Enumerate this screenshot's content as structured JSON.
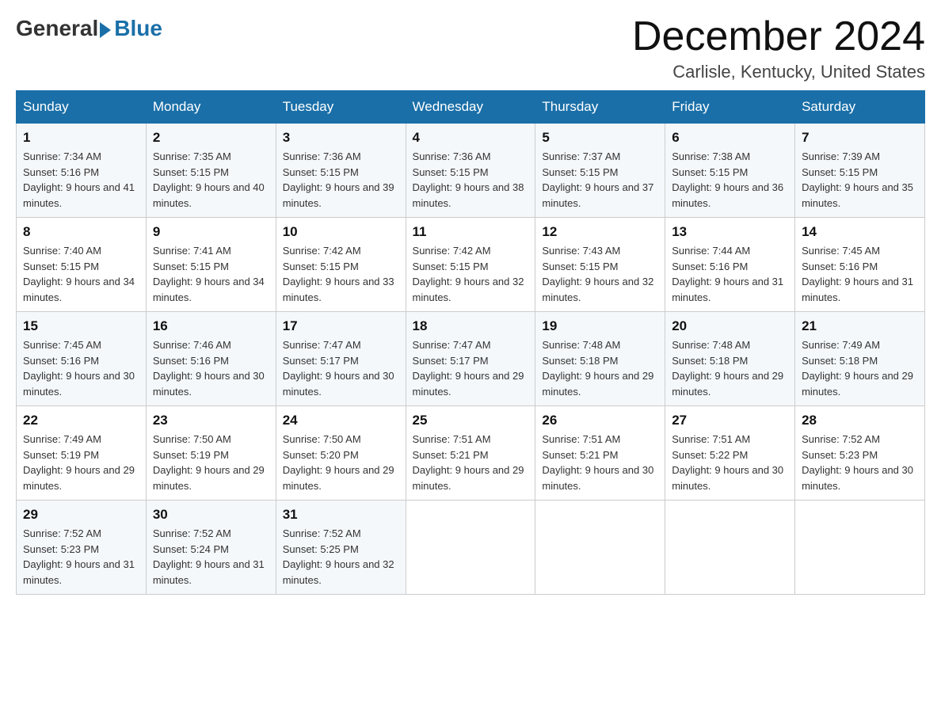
{
  "header": {
    "logo_general": "General",
    "logo_blue": "Blue",
    "month_title": "December 2024",
    "subtitle": "Carlisle, Kentucky, United States"
  },
  "weekdays": [
    "Sunday",
    "Monday",
    "Tuesday",
    "Wednesday",
    "Thursday",
    "Friday",
    "Saturday"
  ],
  "weeks": [
    [
      {
        "day": "1",
        "sunrise": "7:34 AM",
        "sunset": "5:16 PM",
        "daylight": "9 hours and 41 minutes."
      },
      {
        "day": "2",
        "sunrise": "7:35 AM",
        "sunset": "5:15 PM",
        "daylight": "9 hours and 40 minutes."
      },
      {
        "day": "3",
        "sunrise": "7:36 AM",
        "sunset": "5:15 PM",
        "daylight": "9 hours and 39 minutes."
      },
      {
        "day": "4",
        "sunrise": "7:36 AM",
        "sunset": "5:15 PM",
        "daylight": "9 hours and 38 minutes."
      },
      {
        "day": "5",
        "sunrise": "7:37 AM",
        "sunset": "5:15 PM",
        "daylight": "9 hours and 37 minutes."
      },
      {
        "day": "6",
        "sunrise": "7:38 AM",
        "sunset": "5:15 PM",
        "daylight": "9 hours and 36 minutes."
      },
      {
        "day": "7",
        "sunrise": "7:39 AM",
        "sunset": "5:15 PM",
        "daylight": "9 hours and 35 minutes."
      }
    ],
    [
      {
        "day": "8",
        "sunrise": "7:40 AM",
        "sunset": "5:15 PM",
        "daylight": "9 hours and 34 minutes."
      },
      {
        "day": "9",
        "sunrise": "7:41 AM",
        "sunset": "5:15 PM",
        "daylight": "9 hours and 34 minutes."
      },
      {
        "day": "10",
        "sunrise": "7:42 AM",
        "sunset": "5:15 PM",
        "daylight": "9 hours and 33 minutes."
      },
      {
        "day": "11",
        "sunrise": "7:42 AM",
        "sunset": "5:15 PM",
        "daylight": "9 hours and 32 minutes."
      },
      {
        "day": "12",
        "sunrise": "7:43 AM",
        "sunset": "5:15 PM",
        "daylight": "9 hours and 32 minutes."
      },
      {
        "day": "13",
        "sunrise": "7:44 AM",
        "sunset": "5:16 PM",
        "daylight": "9 hours and 31 minutes."
      },
      {
        "day": "14",
        "sunrise": "7:45 AM",
        "sunset": "5:16 PM",
        "daylight": "9 hours and 31 minutes."
      }
    ],
    [
      {
        "day": "15",
        "sunrise": "7:45 AM",
        "sunset": "5:16 PM",
        "daylight": "9 hours and 30 minutes."
      },
      {
        "day": "16",
        "sunrise": "7:46 AM",
        "sunset": "5:16 PM",
        "daylight": "9 hours and 30 minutes."
      },
      {
        "day": "17",
        "sunrise": "7:47 AM",
        "sunset": "5:17 PM",
        "daylight": "9 hours and 30 minutes."
      },
      {
        "day": "18",
        "sunrise": "7:47 AM",
        "sunset": "5:17 PM",
        "daylight": "9 hours and 29 minutes."
      },
      {
        "day": "19",
        "sunrise": "7:48 AM",
        "sunset": "5:18 PM",
        "daylight": "9 hours and 29 minutes."
      },
      {
        "day": "20",
        "sunrise": "7:48 AM",
        "sunset": "5:18 PM",
        "daylight": "9 hours and 29 minutes."
      },
      {
        "day": "21",
        "sunrise": "7:49 AM",
        "sunset": "5:18 PM",
        "daylight": "9 hours and 29 minutes."
      }
    ],
    [
      {
        "day": "22",
        "sunrise": "7:49 AM",
        "sunset": "5:19 PM",
        "daylight": "9 hours and 29 minutes."
      },
      {
        "day": "23",
        "sunrise": "7:50 AM",
        "sunset": "5:19 PM",
        "daylight": "9 hours and 29 minutes."
      },
      {
        "day": "24",
        "sunrise": "7:50 AM",
        "sunset": "5:20 PM",
        "daylight": "9 hours and 29 minutes."
      },
      {
        "day": "25",
        "sunrise": "7:51 AM",
        "sunset": "5:21 PM",
        "daylight": "9 hours and 29 minutes."
      },
      {
        "day": "26",
        "sunrise": "7:51 AM",
        "sunset": "5:21 PM",
        "daylight": "9 hours and 30 minutes."
      },
      {
        "day": "27",
        "sunrise": "7:51 AM",
        "sunset": "5:22 PM",
        "daylight": "9 hours and 30 minutes."
      },
      {
        "day": "28",
        "sunrise": "7:52 AM",
        "sunset": "5:23 PM",
        "daylight": "9 hours and 30 minutes."
      }
    ],
    [
      {
        "day": "29",
        "sunrise": "7:52 AM",
        "sunset": "5:23 PM",
        "daylight": "9 hours and 31 minutes."
      },
      {
        "day": "30",
        "sunrise": "7:52 AM",
        "sunset": "5:24 PM",
        "daylight": "9 hours and 31 minutes."
      },
      {
        "day": "31",
        "sunrise": "7:52 AM",
        "sunset": "5:25 PM",
        "daylight": "9 hours and 32 minutes."
      },
      null,
      null,
      null,
      null
    ]
  ]
}
